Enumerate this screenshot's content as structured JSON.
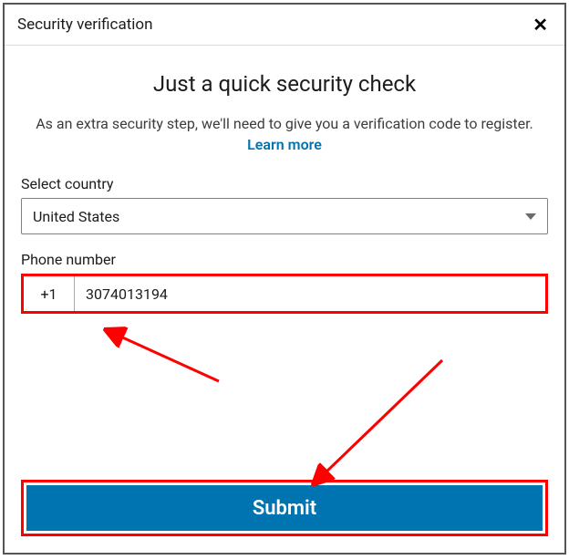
{
  "header": {
    "title": "Security verification"
  },
  "content": {
    "heading": "Just a quick security check",
    "subtext_before": "As an extra security step, we'll need to give you a verification code to register. ",
    "learn_more": "Learn more"
  },
  "country": {
    "label": "Select country",
    "selected": "United States"
  },
  "phone": {
    "label": "Phone number",
    "code": "+1",
    "value": "3074013194"
  },
  "submit": {
    "label": "Submit"
  },
  "annotations": {
    "highlight_color": "#ff0000"
  }
}
